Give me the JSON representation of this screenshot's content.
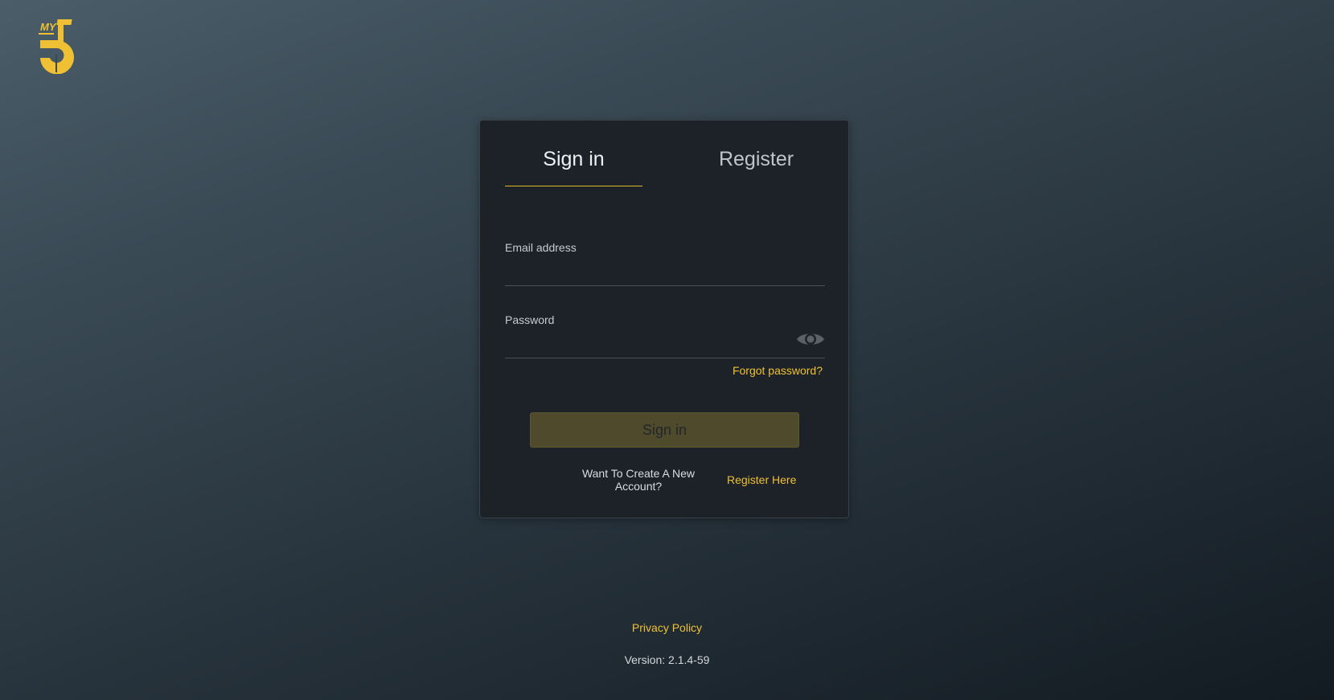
{
  "logo": {
    "text": "MY",
    "icon": "my5-logo-icon",
    "color": "#f0c034"
  },
  "tabs": [
    {
      "label": "Sign in",
      "active": true
    },
    {
      "label": "Register",
      "active": false
    }
  ],
  "form": {
    "email_label": "Email address",
    "email_value": "",
    "password_label": "Password",
    "password_value": "",
    "show_password_icon": "eye-icon",
    "forgot_password": "Forgot password?",
    "submit_label": "Sign in",
    "create_account_text": "Want To Create A New Account?",
    "register_link": "Register Here"
  },
  "footer": {
    "privacy_link": "Privacy Policy",
    "version": "Version: 2.1.4-59"
  },
  "colors": {
    "accent": "#f0c034",
    "card_bg": "#1d2228",
    "button_disabled_bg": "#4e4a2b"
  }
}
